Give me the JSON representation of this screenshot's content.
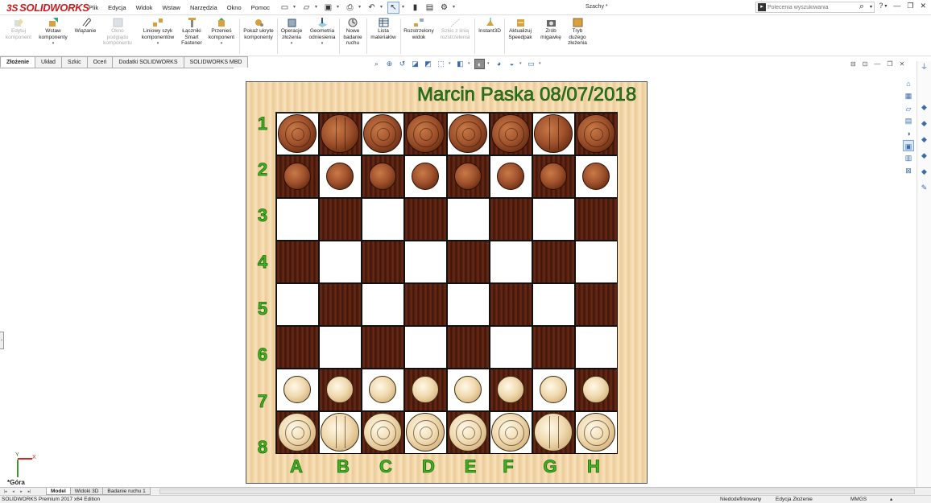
{
  "app": {
    "logo": "SOLIDWORKS",
    "logo_mark": "3S",
    "doc_title": "Szachy *"
  },
  "menu": [
    "Plik",
    "Edycja",
    "Widok",
    "Wstaw",
    "Narzędzia",
    "Okno",
    "Pomoc"
  ],
  "search": {
    "placeholder": "Polecenia wyszukiwania"
  },
  "ribbon": {
    "edit_component": "Edytuj komponent",
    "insert_components": "Wstaw komponenty",
    "mate": "Wiązanie",
    "component_preview": "Okno podglądu komponentu",
    "linear_pattern": "Liniowy szyk komponentów",
    "smart_fasteners": "Łączniki Smart Fastener",
    "move_component": "Przenieś komponent",
    "show_hidden": "Pokaż ukryte komponenty",
    "assembly_features": "Operacje złożenia",
    "reference_geometry": "Geometria odniesienia",
    "new_motion_study": "Nowe badanie ruchu",
    "bom": "Lista materiałów",
    "exploded_view": "Rozstrzelony widok",
    "explode_line": "Szkic z linią rozstrzelenia",
    "instant3d": "Instant3D",
    "update_speedpak": "Aktualizuj Speedpak",
    "snapshot": "Zrób migawkę",
    "large_assembly": "Tryb dużego złożenia"
  },
  "tabs": [
    "Złożenie",
    "Układ",
    "Szkic",
    "Oceń",
    "Dodatki SOLIDWORKS",
    "SOLIDWORKS MBD"
  ],
  "board": {
    "title": "Marcin Paska 08/07/2018",
    "ranks": [
      "1",
      "2",
      "3",
      "4",
      "5",
      "6",
      "7",
      "8"
    ],
    "files": [
      "A",
      "B",
      "C",
      "D",
      "E",
      "F",
      "G",
      "H"
    ]
  },
  "triad": {
    "x": "X",
    "y": "Y"
  },
  "view": {
    "name": "*Góra"
  },
  "bottom_tabs": [
    "Model",
    "Widoki 3D",
    "Badanie ruchu 1"
  ],
  "status": {
    "edition": "SOLIDWORKS Premium 2017 x64 Edition",
    "definition": "Niedodefiniowany",
    "mode": "Edycja Złożenie",
    "units": "MMGS"
  },
  "colors": {
    "logo_red": "#c41e1e",
    "label_green": "#3fb320",
    "title_green": "#2d7a1b",
    "dark_square": "#4a1a10"
  }
}
